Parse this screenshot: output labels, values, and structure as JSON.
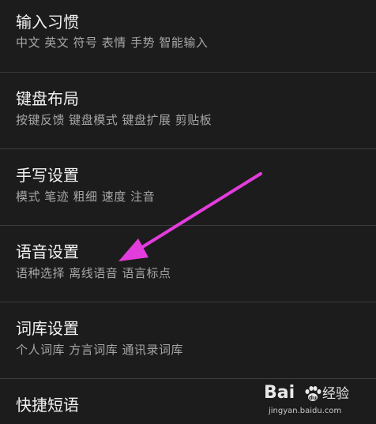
{
  "menu": {
    "items": [
      {
        "title": "输入习惯",
        "subtitle": "中文 英文 符号 表情 手势 智能输入"
      },
      {
        "title": "键盘布局",
        "subtitle": "按键反馈 键盘模式 键盘扩展 剪贴板"
      },
      {
        "title": "手写设置",
        "subtitle": "模式 笔迹 粗细 速度 注音"
      },
      {
        "title": "语音设置",
        "subtitle": "语种选择 离线语音 语言标点"
      },
      {
        "title": "词库设置",
        "subtitle": "个人词库 方言词库 通讯录词库"
      },
      {
        "title": "快捷短语",
        "subtitle": ""
      }
    ]
  },
  "annotation": {
    "arrow_color": "#e23ddc"
  },
  "watermark": {
    "brand": "Bai",
    "suffix": "经验",
    "url": "jingyan.baidu.com"
  },
  "colors": {
    "background": "#1c1c1c",
    "title": "#f2f2f2",
    "subtitle": "#a6a6a6",
    "divider": "#3c3c3c"
  }
}
